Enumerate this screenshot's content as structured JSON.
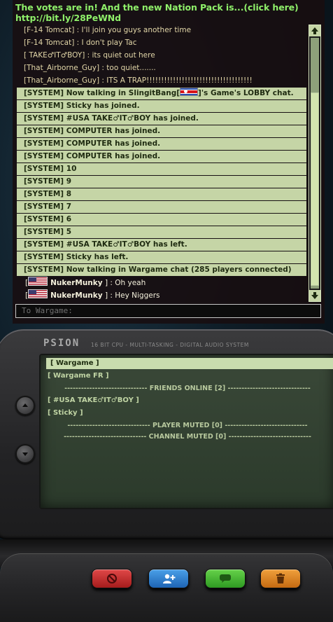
{
  "announcement": {
    "line1": "The votes are in! And the new Nation Pack is...(click here)",
    "line2": "http://bit.ly/28PeWNd"
  },
  "messages": [
    {
      "type": "chat",
      "text": "[F-14 Tomcat] : I'll join you guys another time"
    },
    {
      "type": "chat",
      "text": "[F-14 Tomcat] : I don't play Tac"
    },
    {
      "type": "chat",
      "text": "[ TAKE♂IT♂BOY] : its quiet out here"
    },
    {
      "type": "chat",
      "text": "[That_Airborne_Guy] : too quiet......."
    },
    {
      "type": "chat",
      "text": "[That_Airborne_Guy] : ITS A TRAP!!!!!!!!!!!!!!!!!!!!!!!!!!!!!!!!!!!!"
    },
    {
      "type": "system",
      "text_pre": "[SYSTEM] Now talking in SlingitBang[",
      "text_post": "]'s Game's LOBBY chat.",
      "flag": true
    },
    {
      "type": "system",
      "text": "[SYSTEM] Sticky has joined."
    },
    {
      "type": "system",
      "text": "[SYSTEM] #USA TAKE♂IT♂BOY has joined."
    },
    {
      "type": "system",
      "text": "[SYSTEM] COMPUTER has joined."
    },
    {
      "type": "system",
      "text": "[SYSTEM] COMPUTER has joined."
    },
    {
      "type": "system",
      "text": "[SYSTEM] COMPUTER has joined."
    },
    {
      "type": "system",
      "text": "[SYSTEM] 10"
    },
    {
      "type": "system",
      "text": "[SYSTEM] 9"
    },
    {
      "type": "system",
      "text": "[SYSTEM] 8"
    },
    {
      "type": "system",
      "text": "[SYSTEM] 7"
    },
    {
      "type": "system",
      "text": "[SYSTEM] 6"
    },
    {
      "type": "system",
      "text": "[SYSTEM] 5"
    },
    {
      "type": "system",
      "text": "[SYSTEM] #USA TAKE♂IT♂BOY has left."
    },
    {
      "type": "system",
      "text": "[SYSTEM] Sticky has left."
    },
    {
      "type": "system",
      "text": "[SYSTEM] Now talking in Wargame chat (285 players connected)"
    },
    {
      "type": "player",
      "name": "NukerMunky",
      "text": " ] : Oh yeah"
    },
    {
      "type": "player",
      "name": "NukerMunky",
      "text": " ] : Hey Niggers"
    }
  ],
  "input": {
    "placeholder": "To Wargame:"
  },
  "device": {
    "brand": "PSION",
    "subtitle": "16 BIT CPU  -  MULTI-TASKING  -  DIGITAL AUDIO SYSTEM"
  },
  "channels": {
    "items": [
      {
        "label": "[ Wargame ]",
        "active": true
      },
      {
        "label": "[ Wargame FR ]",
        "active": false
      }
    ],
    "friends_header": "------------------------------ FRIENDS ONLINE [2] ------------------------------",
    "friends": [
      "[ #USA TAKE♂IT♂BOY ]",
      "[ Sticky ]"
    ],
    "muted_header": "------------------------------ PLAYER MUTED [0] ------------------------------",
    "channel_muted_header": "------------------------------ CHANNEL MUTED [0] ------------------------------"
  },
  "colors": {
    "announce": "#8ff06a",
    "system_row": "#c5d5a6",
    "screen": "#2b3a2b"
  },
  "icons": {
    "buttons": [
      "block-icon",
      "add-friend-icon",
      "chat-icon",
      "trash-icon"
    ],
    "side": [
      "chevron-up-icon",
      "chevron-down-icon"
    ]
  }
}
